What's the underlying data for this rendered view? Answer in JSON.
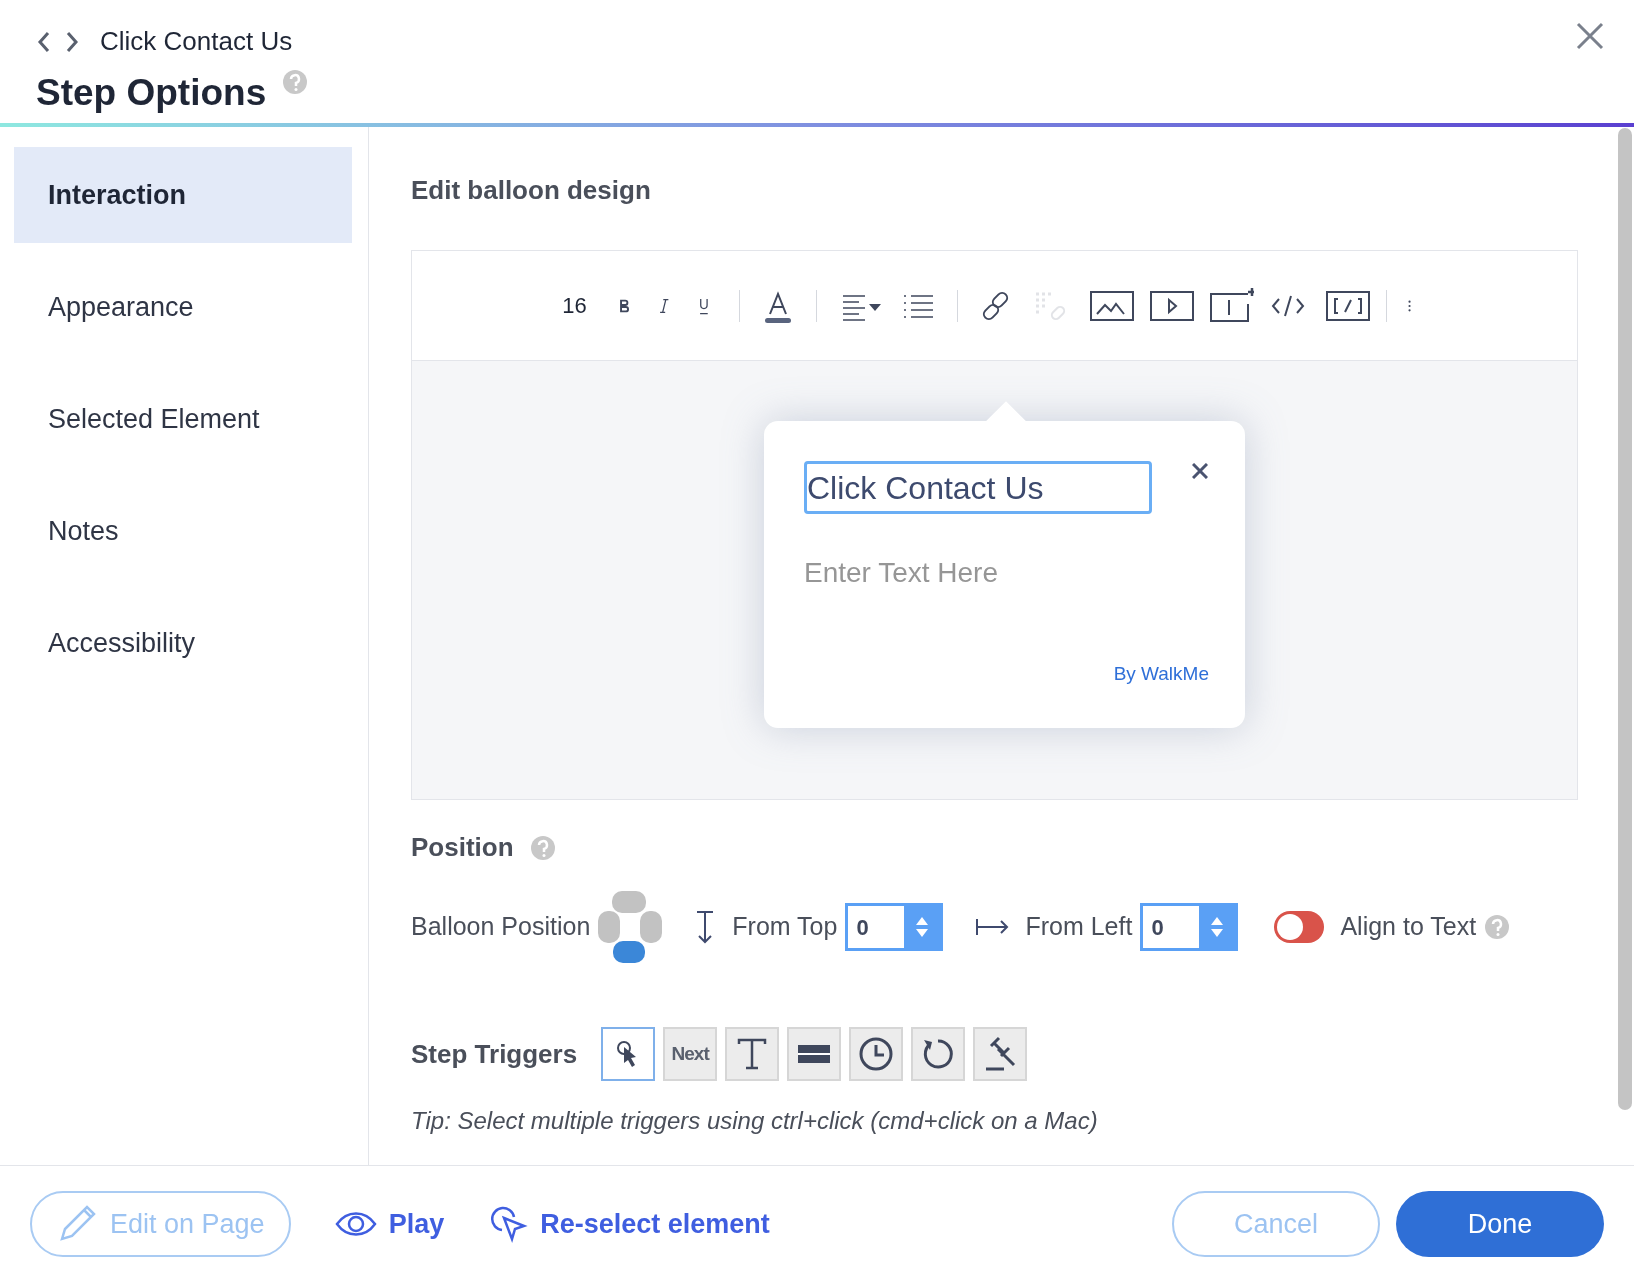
{
  "header": {
    "breadcrumb": "Click Contact Us",
    "title": "Step Options"
  },
  "sidebar": {
    "items": [
      {
        "label": "Interaction",
        "selected": true
      },
      {
        "label": "Appearance",
        "selected": false
      },
      {
        "label": "Selected Element",
        "selected": false
      },
      {
        "label": "Notes",
        "selected": false
      },
      {
        "label": "Accessibility",
        "selected": false
      }
    ]
  },
  "editor": {
    "title": "Edit balloon design",
    "font_size": "16",
    "toolbar_groups": [
      [
        {
          "kind": "bold",
          "disabled": false
        },
        {
          "kind": "italic",
          "disabled": false
        },
        {
          "kind": "underline",
          "disabled": false
        }
      ],
      [
        {
          "kind": "color",
          "disabled": false
        }
      ],
      [
        {
          "kind": "align",
          "disabled": false
        },
        {
          "kind": "list",
          "disabled": false
        }
      ],
      [
        {
          "kind": "link",
          "disabled": false
        },
        {
          "kind": "unlink",
          "disabled": true
        },
        {
          "kind": "image",
          "disabled": false
        },
        {
          "kind": "video",
          "disabled": false
        },
        {
          "kind": "field",
          "disabled": false
        },
        {
          "kind": "code",
          "disabled": false
        },
        {
          "kind": "shortcode",
          "disabled": false
        }
      ],
      [
        {
          "kind": "more",
          "disabled": false
        }
      ]
    ],
    "balloon": {
      "title": "Click Contact Us",
      "placeholder": "Enter Text Here",
      "branding": "By WalkMe"
    }
  },
  "position": {
    "title": "Position",
    "balloon_position_label": "Balloon Position",
    "sides": [
      {
        "selected": false
      },
      {
        "selected": false
      },
      {
        "selected": false
      },
      {
        "selected": true
      }
    ],
    "from_top": {
      "label": "From Top",
      "value": "0"
    },
    "from_left": {
      "label": "From Left",
      "value": "0"
    },
    "align_to_text": {
      "label": "Align to Text",
      "on": false
    }
  },
  "step_triggers": {
    "title": "Step Triggers",
    "items": [
      {
        "kind": "click",
        "selected": true
      },
      {
        "kind": "next",
        "label": "Next",
        "selected": false
      },
      {
        "kind": "text",
        "selected": false
      },
      {
        "kind": "bar",
        "selected": false
      },
      {
        "kind": "timer",
        "selected": false
      },
      {
        "kind": "refresh",
        "selected": false
      },
      {
        "kind": "gavel",
        "selected": false
      }
    ],
    "tip": "Tip: Select multiple triggers using ctrl+click (cmd+click on a Mac)"
  },
  "footer": {
    "actions": [
      {
        "kind": "edit",
        "label": "Edit on Page"
      },
      {
        "kind": "play",
        "label": "Play"
      },
      {
        "kind": "reselect",
        "label": "Re-select element"
      }
    ],
    "buttons": [
      {
        "kind": "outline",
        "label": "Cancel"
      },
      {
        "kind": "primary",
        "label": "Done"
      }
    ]
  }
}
